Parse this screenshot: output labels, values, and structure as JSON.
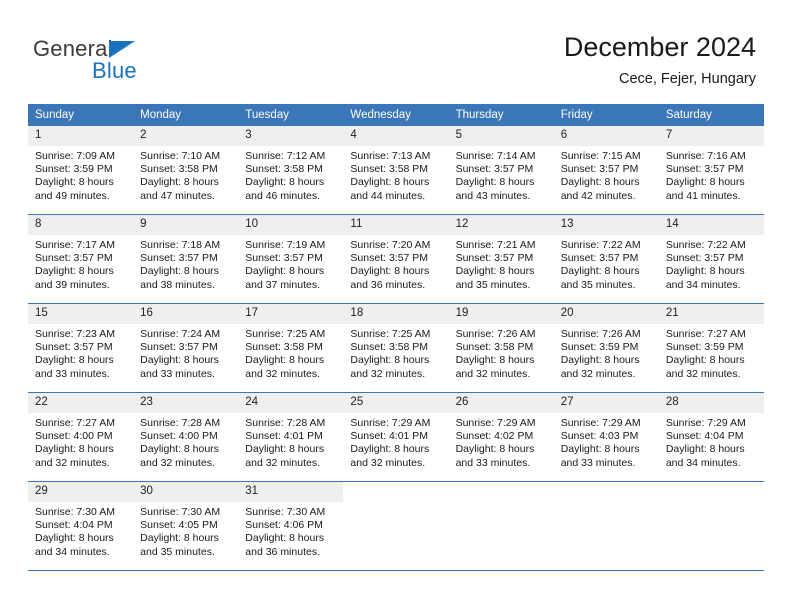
{
  "brand": {
    "name_part1": "General",
    "name_part2": "Blue",
    "color_dark": "#3b3b3b",
    "color_blue": "#1b72bc"
  },
  "header": {
    "title": "December 2024",
    "subtitle": "Cece, Fejer, Hungary"
  },
  "theme": {
    "header_bg": "#3b76b8",
    "daynum_bg": "#efefef",
    "grid_line": "#3b76b8"
  },
  "weekday_headers": [
    "Sunday",
    "Monday",
    "Tuesday",
    "Wednesday",
    "Thursday",
    "Friday",
    "Saturday"
  ],
  "weeks": [
    [
      {
        "day": "1",
        "sunrise": "Sunrise: 7:09 AM",
        "sunset": "Sunset: 3:59 PM",
        "daylight_line1": "Daylight: 8 hours",
        "daylight_line2": "and 49 minutes."
      },
      {
        "day": "2",
        "sunrise": "Sunrise: 7:10 AM",
        "sunset": "Sunset: 3:58 PM",
        "daylight_line1": "Daylight: 8 hours",
        "daylight_line2": "and 47 minutes."
      },
      {
        "day": "3",
        "sunrise": "Sunrise: 7:12 AM",
        "sunset": "Sunset: 3:58 PM",
        "daylight_line1": "Daylight: 8 hours",
        "daylight_line2": "and 46 minutes."
      },
      {
        "day": "4",
        "sunrise": "Sunrise: 7:13 AM",
        "sunset": "Sunset: 3:58 PM",
        "daylight_line1": "Daylight: 8 hours",
        "daylight_line2": "and 44 minutes."
      },
      {
        "day": "5",
        "sunrise": "Sunrise: 7:14 AM",
        "sunset": "Sunset: 3:57 PM",
        "daylight_line1": "Daylight: 8 hours",
        "daylight_line2": "and 43 minutes."
      },
      {
        "day": "6",
        "sunrise": "Sunrise: 7:15 AM",
        "sunset": "Sunset: 3:57 PM",
        "daylight_line1": "Daylight: 8 hours",
        "daylight_line2": "and 42 minutes."
      },
      {
        "day": "7",
        "sunrise": "Sunrise: 7:16 AM",
        "sunset": "Sunset: 3:57 PM",
        "daylight_line1": "Daylight: 8 hours",
        "daylight_line2": "and 41 minutes."
      }
    ],
    [
      {
        "day": "8",
        "sunrise": "Sunrise: 7:17 AM",
        "sunset": "Sunset: 3:57 PM",
        "daylight_line1": "Daylight: 8 hours",
        "daylight_line2": "and 39 minutes."
      },
      {
        "day": "9",
        "sunrise": "Sunrise: 7:18 AM",
        "sunset": "Sunset: 3:57 PM",
        "daylight_line1": "Daylight: 8 hours",
        "daylight_line2": "and 38 minutes."
      },
      {
        "day": "10",
        "sunrise": "Sunrise: 7:19 AM",
        "sunset": "Sunset: 3:57 PM",
        "daylight_line1": "Daylight: 8 hours",
        "daylight_line2": "and 37 minutes."
      },
      {
        "day": "11",
        "sunrise": "Sunrise: 7:20 AM",
        "sunset": "Sunset: 3:57 PM",
        "daylight_line1": "Daylight: 8 hours",
        "daylight_line2": "and 36 minutes."
      },
      {
        "day": "12",
        "sunrise": "Sunrise: 7:21 AM",
        "sunset": "Sunset: 3:57 PM",
        "daylight_line1": "Daylight: 8 hours",
        "daylight_line2": "and 35 minutes."
      },
      {
        "day": "13",
        "sunrise": "Sunrise: 7:22 AM",
        "sunset": "Sunset: 3:57 PM",
        "daylight_line1": "Daylight: 8 hours",
        "daylight_line2": "and 35 minutes."
      },
      {
        "day": "14",
        "sunrise": "Sunrise: 7:22 AM",
        "sunset": "Sunset: 3:57 PM",
        "daylight_line1": "Daylight: 8 hours",
        "daylight_line2": "and 34 minutes."
      }
    ],
    [
      {
        "day": "15",
        "sunrise": "Sunrise: 7:23 AM",
        "sunset": "Sunset: 3:57 PM",
        "daylight_line1": "Daylight: 8 hours",
        "daylight_line2": "and 33 minutes."
      },
      {
        "day": "16",
        "sunrise": "Sunrise: 7:24 AM",
        "sunset": "Sunset: 3:57 PM",
        "daylight_line1": "Daylight: 8 hours",
        "daylight_line2": "and 33 minutes."
      },
      {
        "day": "17",
        "sunrise": "Sunrise: 7:25 AM",
        "sunset": "Sunset: 3:58 PM",
        "daylight_line1": "Daylight: 8 hours",
        "daylight_line2": "and 32 minutes."
      },
      {
        "day": "18",
        "sunrise": "Sunrise: 7:25 AM",
        "sunset": "Sunset: 3:58 PM",
        "daylight_line1": "Daylight: 8 hours",
        "daylight_line2": "and 32 minutes."
      },
      {
        "day": "19",
        "sunrise": "Sunrise: 7:26 AM",
        "sunset": "Sunset: 3:58 PM",
        "daylight_line1": "Daylight: 8 hours",
        "daylight_line2": "and 32 minutes."
      },
      {
        "day": "20",
        "sunrise": "Sunrise: 7:26 AM",
        "sunset": "Sunset: 3:59 PM",
        "daylight_line1": "Daylight: 8 hours",
        "daylight_line2": "and 32 minutes."
      },
      {
        "day": "21",
        "sunrise": "Sunrise: 7:27 AM",
        "sunset": "Sunset: 3:59 PM",
        "daylight_line1": "Daylight: 8 hours",
        "daylight_line2": "and 32 minutes."
      }
    ],
    [
      {
        "day": "22",
        "sunrise": "Sunrise: 7:27 AM",
        "sunset": "Sunset: 4:00 PM",
        "daylight_line1": "Daylight: 8 hours",
        "daylight_line2": "and 32 minutes."
      },
      {
        "day": "23",
        "sunrise": "Sunrise: 7:28 AM",
        "sunset": "Sunset: 4:00 PM",
        "daylight_line1": "Daylight: 8 hours",
        "daylight_line2": "and 32 minutes."
      },
      {
        "day": "24",
        "sunrise": "Sunrise: 7:28 AM",
        "sunset": "Sunset: 4:01 PM",
        "daylight_line1": "Daylight: 8 hours",
        "daylight_line2": "and 32 minutes."
      },
      {
        "day": "25",
        "sunrise": "Sunrise: 7:29 AM",
        "sunset": "Sunset: 4:01 PM",
        "daylight_line1": "Daylight: 8 hours",
        "daylight_line2": "and 32 minutes."
      },
      {
        "day": "26",
        "sunrise": "Sunrise: 7:29 AM",
        "sunset": "Sunset: 4:02 PM",
        "daylight_line1": "Daylight: 8 hours",
        "daylight_line2": "and 33 minutes."
      },
      {
        "day": "27",
        "sunrise": "Sunrise: 7:29 AM",
        "sunset": "Sunset: 4:03 PM",
        "daylight_line1": "Daylight: 8 hours",
        "daylight_line2": "and 33 minutes."
      },
      {
        "day": "28",
        "sunrise": "Sunrise: 7:29 AM",
        "sunset": "Sunset: 4:04 PM",
        "daylight_line1": "Daylight: 8 hours",
        "daylight_line2": "and 34 minutes."
      }
    ],
    [
      {
        "day": "29",
        "sunrise": "Sunrise: 7:30 AM",
        "sunset": "Sunset: 4:04 PM",
        "daylight_line1": "Daylight: 8 hours",
        "daylight_line2": "and 34 minutes."
      },
      {
        "day": "30",
        "sunrise": "Sunrise: 7:30 AM",
        "sunset": "Sunset: 4:05 PM",
        "daylight_line1": "Daylight: 8 hours",
        "daylight_line2": "and 35 minutes."
      },
      {
        "day": "31",
        "sunrise": "Sunrise: 7:30 AM",
        "sunset": "Sunset: 4:06 PM",
        "daylight_line1": "Daylight: 8 hours",
        "daylight_line2": "and 36 minutes."
      },
      {
        "day": "",
        "sunrise": "",
        "sunset": "",
        "daylight_line1": "",
        "daylight_line2": ""
      },
      {
        "day": "",
        "sunrise": "",
        "sunset": "",
        "daylight_line1": "",
        "daylight_line2": ""
      },
      {
        "day": "",
        "sunrise": "",
        "sunset": "",
        "daylight_line1": "",
        "daylight_line2": ""
      },
      {
        "day": "",
        "sunrise": "",
        "sunset": "",
        "daylight_line1": "",
        "daylight_line2": ""
      }
    ]
  ]
}
